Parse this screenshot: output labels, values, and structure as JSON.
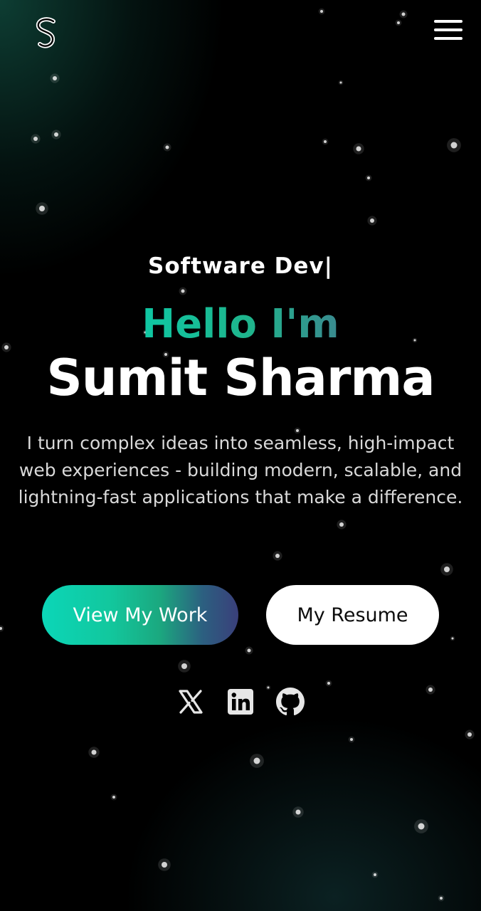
{
  "header": {
    "logo_icon": "stylized-s-logo",
    "menu_icon": "hamburger-menu-icon"
  },
  "hero": {
    "role": "Software Dev|",
    "greeting": "Hello I'm",
    "name": "Sumit Sharma",
    "bio": "I turn complex ideas into seamless, high-impact web experiences - building modern, scalable, and lightning-fast applications that make a difference."
  },
  "buttons": {
    "view_work_label": "View My Work",
    "resume_label": "My Resume"
  },
  "social": [
    {
      "icon": "x-twitter-icon"
    },
    {
      "icon": "linkedin-icon"
    },
    {
      "icon": "github-icon"
    }
  ],
  "colors": {
    "accent": "#12c79d",
    "background": "#000000",
    "text": "#ffffff"
  }
}
